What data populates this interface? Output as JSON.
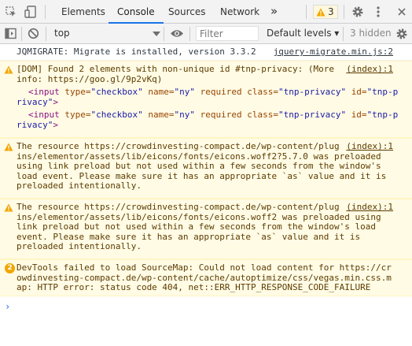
{
  "tabs": {
    "elements": "Elements",
    "console": "Console",
    "sources": "Sources",
    "network": "Network",
    "more": "»"
  },
  "warning_count": "3",
  "toolbar": {
    "context": "top",
    "filter_placeholder": "Filter",
    "levels": "Default levels ▾",
    "hidden": "3 hidden"
  },
  "messages": [
    {
      "type": "log",
      "lines": [
        "JQMIGRATE: Migrate is installed, version 3.3.2"
      ],
      "source": "jquery-migrate.min.js:2"
    },
    {
      "type": "warning",
      "lines": [
        "[DOM] Found 2 elements with non-unique id #tnp-privacy: (More",
        "info: https://goo.gl/9p2vKq)"
      ],
      "source": "(index):1",
      "code": [
        {
          "open": "<input",
          "type_attr": "type=",
          "type_val": "\"checkbox\"",
          "name_attr": "name=",
          "name_val": "\"ny\"",
          "req": "required",
          "class_attr": "class=",
          "class_val": "\"tnp-privacy\"",
          "id_attr": "id=",
          "id_val1": "\"tnp-p",
          "id_val2": "rivacy\"",
          "close": ">"
        },
        {
          "open": "<input",
          "type_attr": "type=",
          "type_val": "\"checkbox\"",
          "name_attr": "name=",
          "name_val": "\"ny\"",
          "req": "required",
          "class_attr": "class=",
          "class_val": "\"tnp-privacy\"",
          "id_attr": "id=",
          "id_val1": "\"tnp-p",
          "id_val2": "rivacy\"",
          "close": ">"
        }
      ]
    },
    {
      "type": "warning",
      "lines": [
        "The resource https://crowdinvesting-compact.de/wp-content/plug",
        "ins/elementor/assets/lib/eicons/fonts/eicons.woff2?5.7.0 was preloaded",
        "using link preload but not used within a few seconds from the window's",
        "load event. Please make sure it has an appropriate `as` value and it is",
        "preloaded intentionally."
      ],
      "source": "(index):1"
    },
    {
      "type": "warning",
      "lines": [
        "The resource https://crowdinvesting-compact.de/wp-content/plug",
        "ins/elementor/assets/lib/eicons/fonts/eicons.woff2 was preloaded using",
        "link preload but not used within a few seconds from the window's load",
        "event. Please make sure it has an appropriate `as` value and it is",
        "preloaded intentionally."
      ],
      "source": "(index):1"
    },
    {
      "type": "info",
      "badge": "2",
      "lines": [
        "DevTools failed to load SourceMap: Could not load content for https://cr",
        "owdinvesting-compact.de/wp-content/cache/autoptimize/css/vegas.min.css.m",
        "ap: HTTP error: status code 404, net::ERR_HTTP_RESPONSE_CODE_FAILURE"
      ]
    }
  ],
  "prompt_symbol": "›",
  "colors": {
    "warning_bg": "#fffbe5",
    "warning_text": "#5c3c00",
    "warning_icon": "#f2a600",
    "accent": "#1a73e8"
  }
}
